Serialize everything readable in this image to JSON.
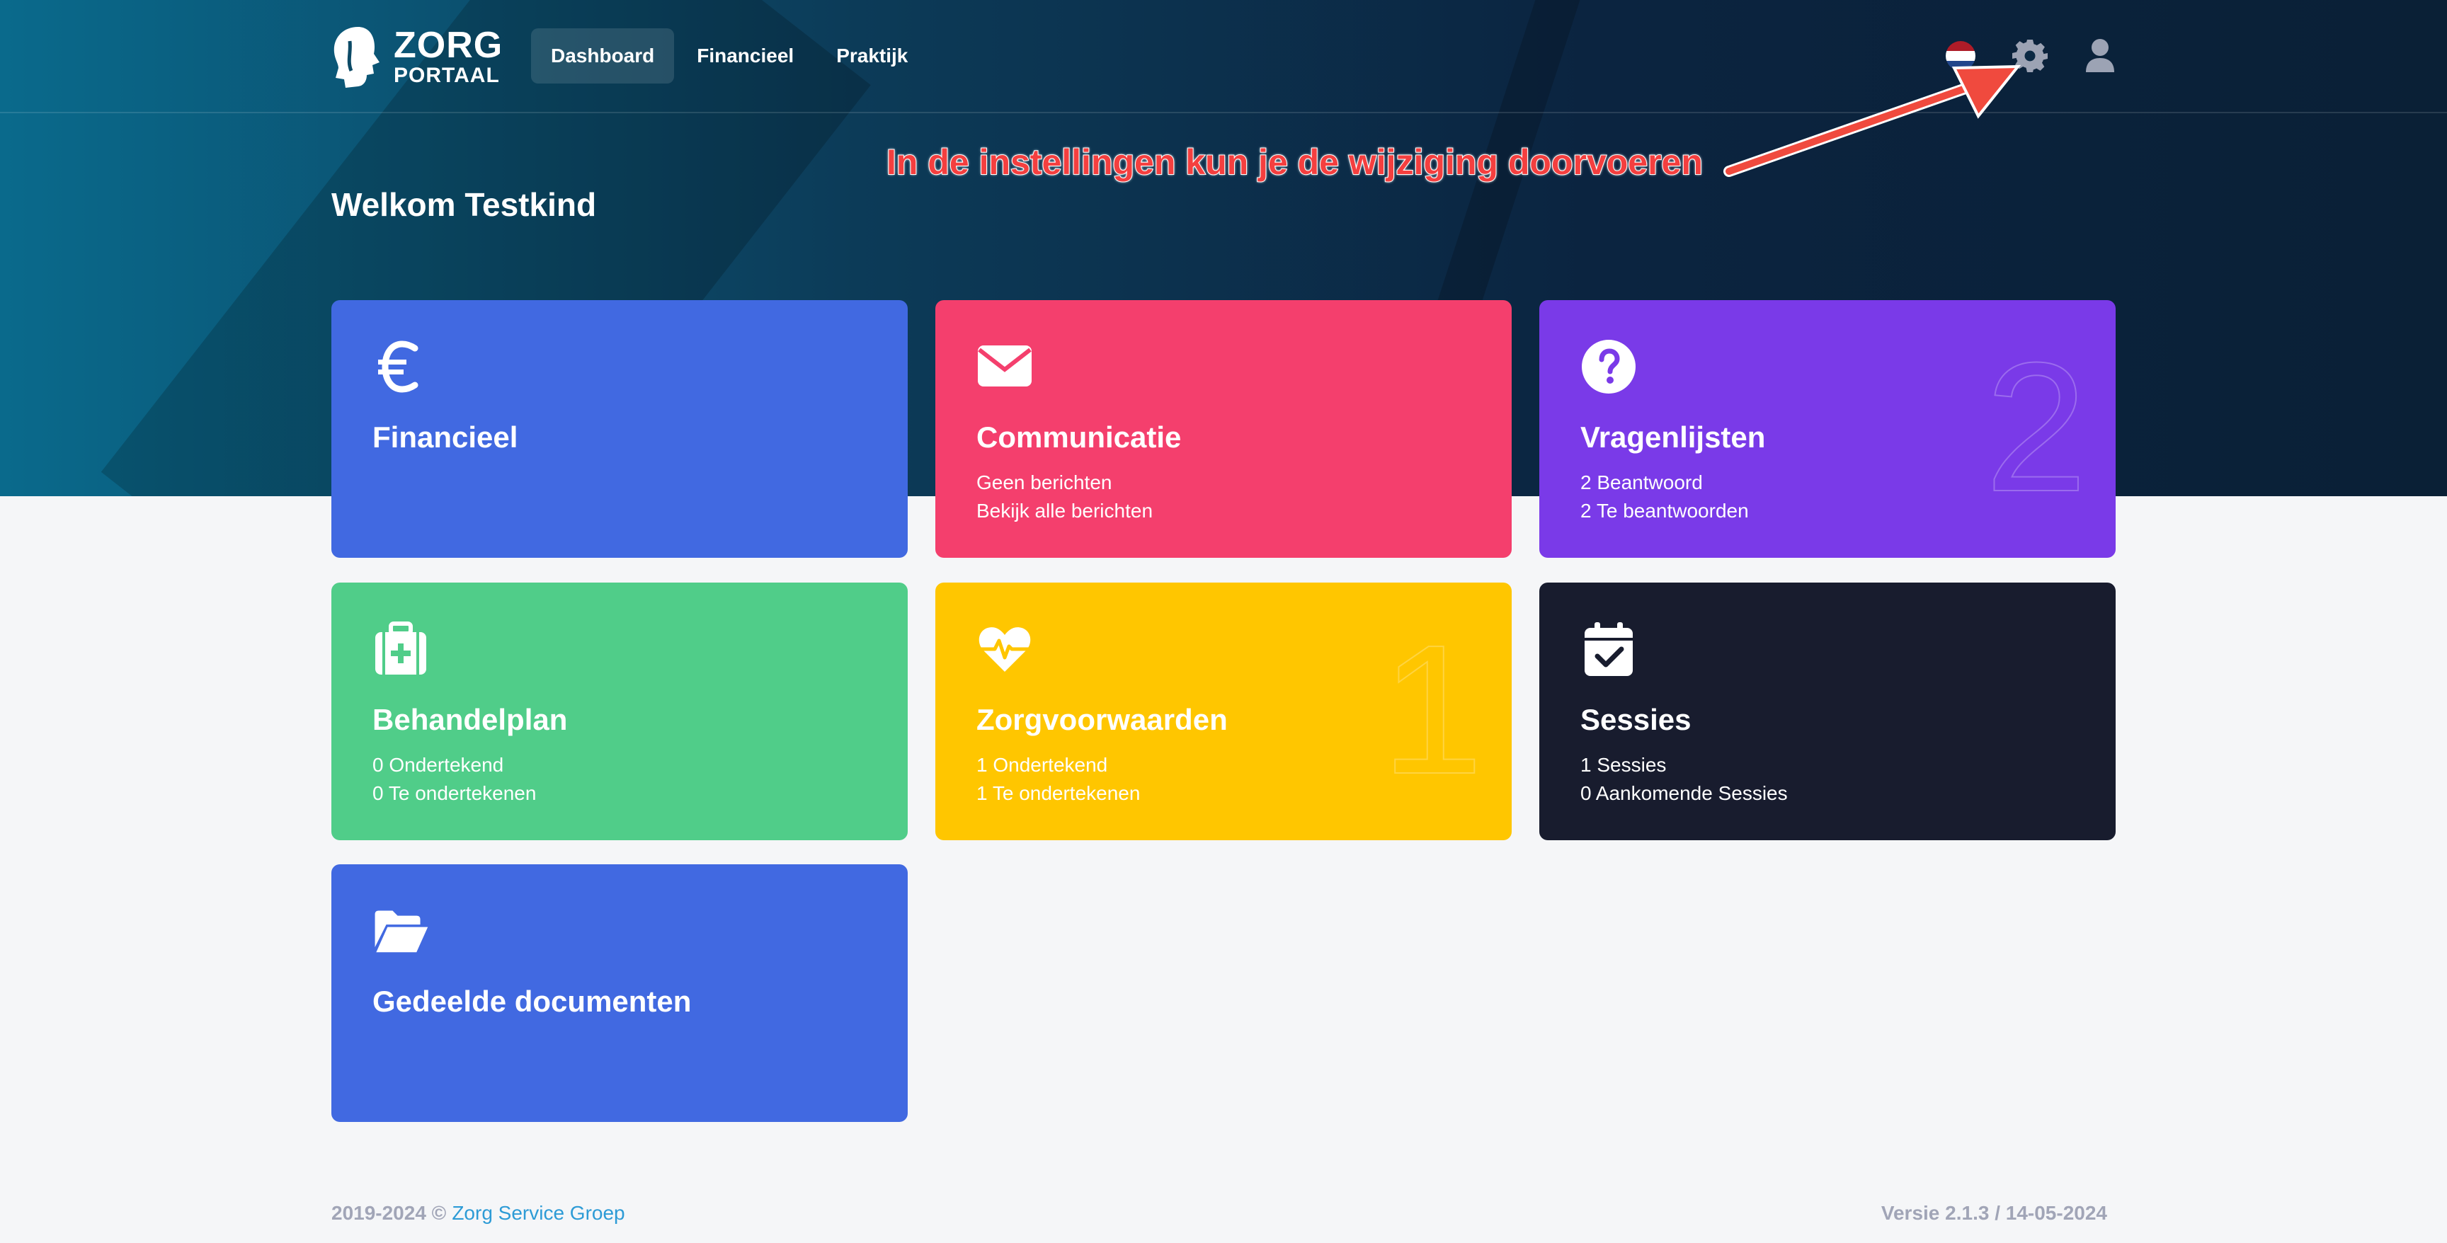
{
  "brand": {
    "line1": "ZORG",
    "line2": "PORTAAL"
  },
  "nav": {
    "items": [
      {
        "label": "Dashboard",
        "active": true
      },
      {
        "label": "Financieel",
        "active": false
      },
      {
        "label": "Praktijk",
        "active": false
      }
    ]
  },
  "header": {
    "flag_colors": [
      "#ae1c28",
      "#ffffff",
      "#21468b"
    ],
    "settings_icon": "gear-icon",
    "user_icon": "user-icon"
  },
  "annotation": "In de instellingen kun je de wijziging doorvoeren",
  "welcome": "Welkom Testkind",
  "cards": [
    {
      "title": "Financieel",
      "lines": [],
      "icon": "euro-icon",
      "color": "#4169e1"
    },
    {
      "title": "Communicatie",
      "lines": [
        "Geen berichten",
        "Bekijk alle berichten"
      ],
      "icon": "envelope-icon",
      "color": "#f43f6d"
    },
    {
      "title": "Vragenlijsten",
      "lines": [
        "2 Beantwoord",
        "2 Te beantwoorden"
      ],
      "icon": "question-circle-icon",
      "color": "#7a3ae8",
      "badge": "2"
    },
    {
      "title": "Behandelplan",
      "lines": [
        "0 Ondertekend",
        "0 Te ondertekenen"
      ],
      "icon": "medkit-icon",
      "color": "#50cd89"
    },
    {
      "title": "Zorgvoorwaarden",
      "lines": [
        "1 Ondertekend",
        "1 Te ondertekenen"
      ],
      "icon": "heartbeat-icon",
      "color": "#ffc600",
      "badge": "1"
    },
    {
      "title": "Sessies",
      "lines": [
        "1 Sessies",
        "0 Aankomende Sessies"
      ],
      "icon": "calendar-check-icon",
      "color": "#181c2e"
    },
    {
      "title": "Gedeelde documenten",
      "lines": [],
      "icon": "folder-open-icon",
      "color": "#4169e1"
    }
  ],
  "footer": {
    "copyright": "2019-2024 ©",
    "company": "Zorg Service Groep",
    "version": "Versie 2.1.3 / 14-05-2024"
  }
}
